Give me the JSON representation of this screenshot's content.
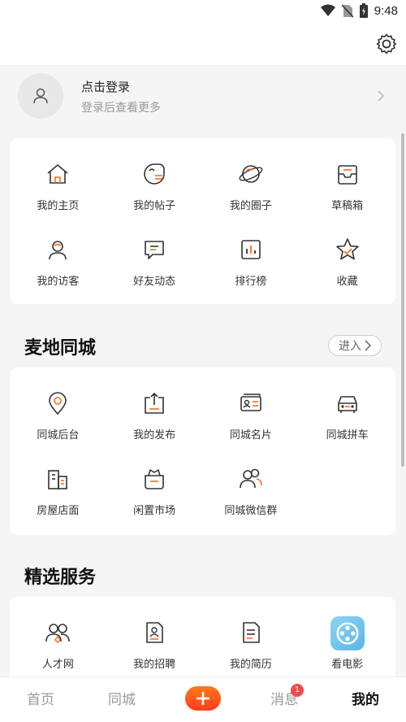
{
  "status": {
    "time": "9:48"
  },
  "login": {
    "title": "点击登录",
    "subtitle": "登录后查看更多"
  },
  "personal": [
    {
      "label": "我的主页",
      "icon": "home-icon"
    },
    {
      "label": "我的帖子",
      "icon": "post-icon"
    },
    {
      "label": "我的圈子",
      "icon": "planet-icon"
    },
    {
      "label": "草稿箱",
      "icon": "drafts-icon"
    },
    {
      "label": "我的访客",
      "icon": "visitor-icon"
    },
    {
      "label": "好友动态",
      "icon": "chat-icon"
    },
    {
      "label": "排行榜",
      "icon": "ranking-icon"
    },
    {
      "label": "收藏",
      "icon": "star-icon"
    }
  ],
  "city": {
    "title": "麦地同城",
    "enter": "进入",
    "items": [
      {
        "label": "同城后台",
        "icon": "location-icon"
      },
      {
        "label": "我的发布",
        "icon": "upload-icon"
      },
      {
        "label": "同城名片",
        "icon": "card-icon"
      },
      {
        "label": "同城拼车",
        "icon": "car-icon"
      },
      {
        "label": "房屋店面",
        "icon": "building-icon"
      },
      {
        "label": "闲置市场",
        "icon": "basket-icon"
      },
      {
        "label": "同城微信群",
        "icon": "group-icon"
      }
    ]
  },
  "services": {
    "title": "精选服务",
    "items": [
      {
        "label": "人才网",
        "icon": "talent-icon"
      },
      {
        "label": "我的招聘",
        "icon": "recruit-icon"
      },
      {
        "label": "我的简历",
        "icon": "resume-icon"
      },
      {
        "label": "看电影",
        "icon": "movie-icon"
      }
    ]
  },
  "tabs": [
    {
      "label": "首页"
    },
    {
      "label": "同城"
    },
    {
      "label": ""
    },
    {
      "label": "消息",
      "badge": "1"
    },
    {
      "label": "我的"
    }
  ],
  "colors": {
    "accent": "#ff6a1a",
    "badge": "#f24a4a"
  }
}
